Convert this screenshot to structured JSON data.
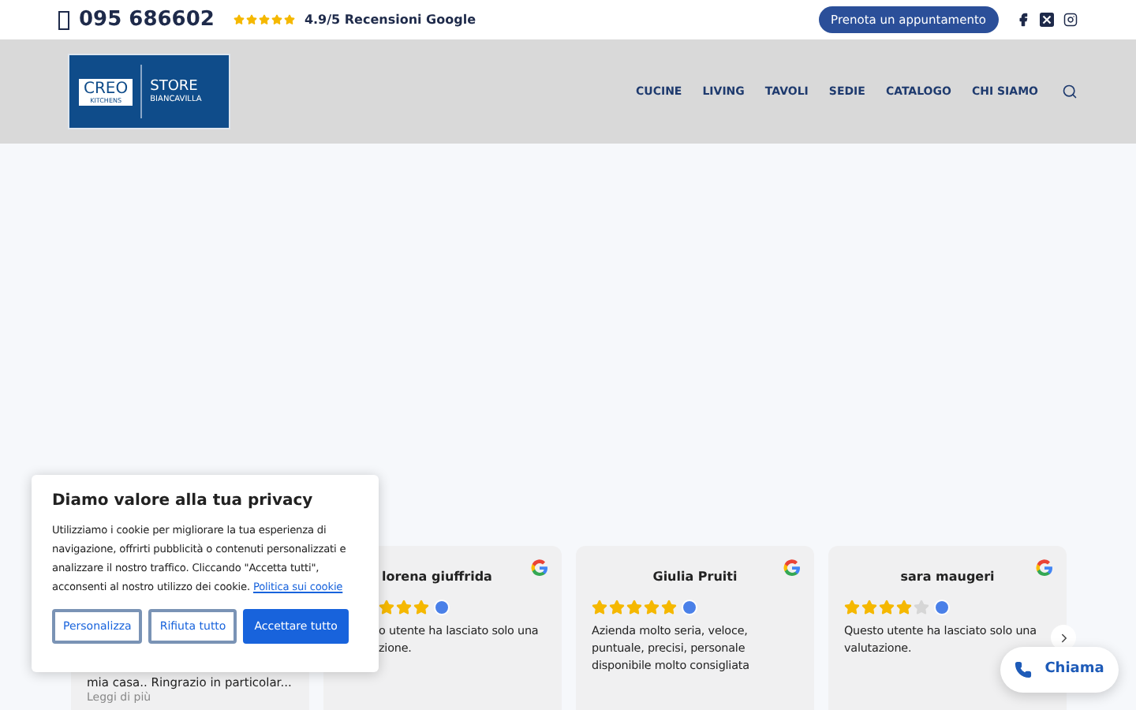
{
  "topbar": {
    "phone": "095 686602",
    "stars": 5,
    "rating": "4.9/5 Recensioni Google",
    "cta": "Prenota un appuntamento"
  },
  "header": {
    "logo": {
      "brand": "CREO",
      "sub": "KITCHENS",
      "store": "STORE",
      "city": "BIANCAVILLA"
    },
    "nav": [
      {
        "label": "CUCINE"
      },
      {
        "label": "LIVING"
      },
      {
        "label": "TAVOLI"
      },
      {
        "label": "SEDIE"
      },
      {
        "label": "CATALOGO"
      },
      {
        "label": "CHI SIAMO"
      }
    ]
  },
  "reviews": [
    {
      "kind": "tail",
      "lines": [
        "mia casa.. Ringrazio in particolar..."
      ],
      "more": "Leggi di più"
    },
    {
      "kind": "partial",
      "name": "lorena giuffrida",
      "stars": 3,
      "lines": [
        "o utente ha lasciato solo una",
        "zione."
      ]
    },
    {
      "kind": "full",
      "name": "Giulia Pruiti",
      "stars": 5,
      "lines": [
        "Azienda molto seria, veloce,",
        "puntuale, precisi, personale",
        "disponibile molto consigliata"
      ]
    },
    {
      "kind": "full",
      "name": "sara maugeri",
      "stars": 4,
      "lines": [
        "Questo utente ha lasciato solo una",
        "valutazione."
      ]
    }
  ],
  "cookie": {
    "title": "Diamo valore alla tua privacy",
    "body": "Utilizziamo i cookie per migliorare la tua esperienza di navigazione, offrirti pubblicità o contenuti personalizzati e analizzare il nostro traffico. Cliccando \"Accetta tutti\", acconsenti al nostro utilizzo dei cookie.",
    "link": "Politica sui cookie",
    "buttons": [
      {
        "label": "Personalizza",
        "kind": "outline"
      },
      {
        "label": "Rifiuta tutto",
        "kind": "outline"
      },
      {
        "label": "Accettare tutto",
        "kind": "primary"
      }
    ]
  },
  "call": {
    "label": "Chiama"
  }
}
